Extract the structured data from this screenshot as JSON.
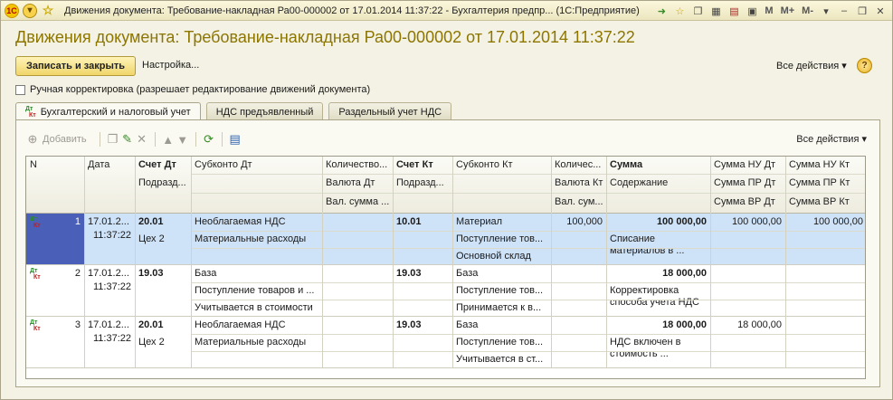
{
  "window": {
    "title": "Движения документа: Требование-накладная Ра00-000002 от 17.01.2014 11:37:22 - Бухгалтерия предпр... (1С:Предприятие)",
    "logo_text": "1С",
    "m_buttons": [
      "M",
      "M+",
      "M-"
    ]
  },
  "page": {
    "heading": "Движения документа: Требование-накладная Ра00-000002 от 17.01.2014 11:37:22",
    "save_close": "Записать и закрыть",
    "settings": "Настройка...",
    "all_actions": "Все действия",
    "help": "?",
    "manual_adjust": "Ручная корректировка (разрешает редактирование движений документа)"
  },
  "tabs": [
    {
      "label": "Бухгалтерский и налоговый учет",
      "active": true
    },
    {
      "label": "НДС предъявленный",
      "active": false
    },
    {
      "label": "Раздельный учет НДС",
      "active": false
    }
  ],
  "toolbar": {
    "add": "Добавить",
    "all_actions": "Все действия"
  },
  "icon_marks": {
    "dt": "Дт",
    "kt": "Кт"
  },
  "columns": {
    "n": "N",
    "date": "Дата",
    "acc_dt": "Счет Дт",
    "dept_dt": "Подразд...",
    "subconto_dt": "Субконто Дт",
    "qty_dt": "Количество...",
    "cur_dt": "Валюта Дт",
    "cur_sum_dt": "Вал. сумма ...",
    "acc_kt": "Счет Кт",
    "dept_kt": "Подразд...",
    "subconto_kt": "Субконто Кт",
    "qty_kt": "Количес...",
    "cur_kt": "Валюта Кт",
    "cur_sum_kt": "Вал. сум...",
    "sum": "Сумма",
    "content": "Содержание",
    "nu_dt": "Сумма НУ Дт",
    "pr_dt": "Сумма ПР Дт",
    "vr_dt": "Сумма ВР Дт",
    "nu_kt": "Сумма НУ Кт",
    "pr_kt": "Сумма ПР Кт",
    "vr_kt": "Сумма ВР Кт"
  },
  "rows": [
    {
      "n": "1",
      "date": "17.01.2...",
      "time": "11:37:22",
      "acc_dt": "20.01",
      "dept_dt": "Цех 2",
      "sub_dt": [
        "Необлагаемая НДС",
        "Материальные расходы",
        ""
      ],
      "qty_dt": "",
      "acc_kt": "10.01",
      "sub_kt": [
        "Материал",
        "Поступление тов...",
        "Основной склад"
      ],
      "qty_kt": "100,000",
      "sum": "100 000,00",
      "content": "Списание материалов в ...",
      "nu_dt": "100 000,00",
      "nu_kt": "100 000,00"
    },
    {
      "n": "2",
      "date": "17.01.2...",
      "time": "11:37:22",
      "acc_dt": "19.03",
      "dept_dt": "",
      "sub_dt": [
        "База",
        "Поступление товаров и ...",
        "Учитывается в стоимости"
      ],
      "qty_dt": "",
      "acc_kt": "19.03",
      "sub_kt": [
        "База",
        "Поступление тов...",
        "Принимается к в..."
      ],
      "qty_kt": "",
      "sum": "18 000,00",
      "content": "Корректировка способа учета НДС",
      "nu_dt": "",
      "nu_kt": ""
    },
    {
      "n": "3",
      "date": "17.01.2...",
      "time": "11:37:22",
      "acc_dt": "20.01",
      "dept_dt": "Цех 2",
      "sub_dt": [
        "Необлагаемая НДС",
        "Материальные расходы",
        ""
      ],
      "qty_dt": "",
      "acc_kt": "19.03",
      "sub_kt": [
        "База",
        "Поступление тов...",
        "Учитывается в ст..."
      ],
      "qty_kt": "",
      "sum": "18 000,00",
      "content": "НДС включен в стоимость ...",
      "nu_dt": "18 000,00",
      "nu_kt": ""
    }
  ]
}
